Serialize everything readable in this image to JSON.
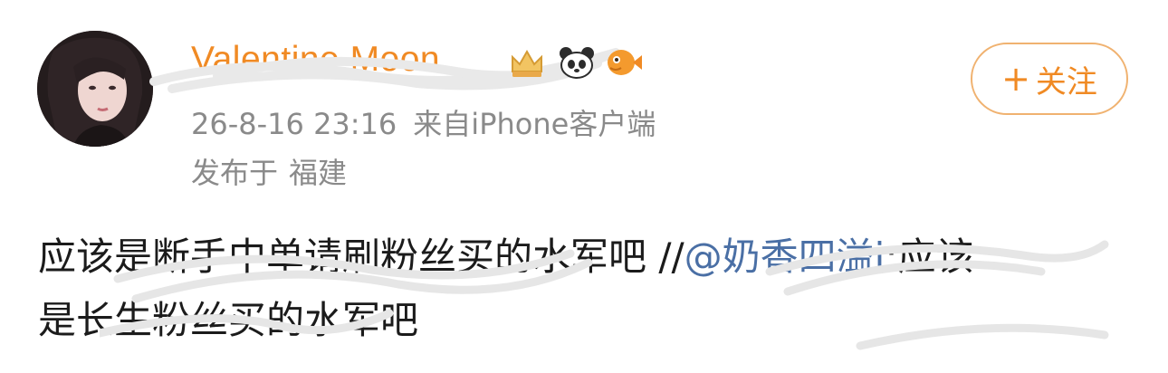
{
  "user": {
    "name": "Valentine Moon",
    "badges": [
      "crown-badge-icon",
      "panda-icon",
      "fish-icon"
    ]
  },
  "follow_button": {
    "icon": "+",
    "label": "关注"
  },
  "meta": {
    "timestamp": "26-8-16 23:16",
    "source_prefix": "来自",
    "client": "iPhone客户端"
  },
  "location": {
    "prefix": "发布于",
    "place": "福建"
  },
  "post": {
    "line1_text": "应该是断手中单请刷粉丝买的水军吧 //",
    "mention": "@奶香四溢i",
    "line1_tail": ":应该",
    "line2_text": "是长生粉丝买的水军吧"
  },
  "colors": {
    "accent": "#f08a24",
    "mention": "#4a6fa5",
    "meta": "#8a8a8a",
    "text": "#1b1b1b"
  }
}
